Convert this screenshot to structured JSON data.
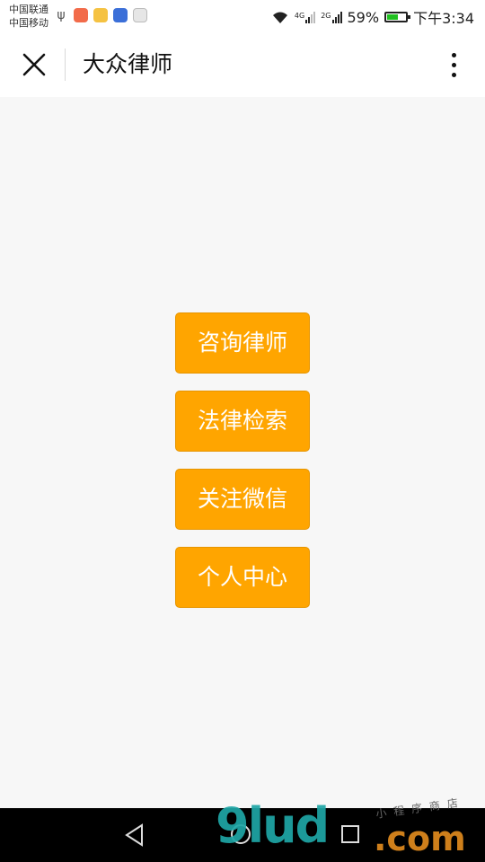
{
  "status_bar": {
    "carrier_1": "中国联通",
    "carrier_2": "中国移动",
    "network_1": "4G",
    "network_2": "2G",
    "battery_text": "59%",
    "battery_level": 0.59,
    "time": "下午3:34",
    "app_icons": [
      "favorites-icon",
      "weibo-icon",
      "baidu-icon",
      "maps-icon"
    ]
  },
  "nav": {
    "title": "大众律师"
  },
  "menu": {
    "items": [
      {
        "label": "咨询律师"
      },
      {
        "label": "法律检索"
      },
      {
        "label": "关注微信"
      },
      {
        "label": "个人中心"
      }
    ]
  },
  "watermark": {
    "main": "9lud",
    "suffix": ".com",
    "caption": "小程序商店"
  },
  "colors": {
    "accent": "#ffa500",
    "page_bg": "#f7f7f7"
  }
}
